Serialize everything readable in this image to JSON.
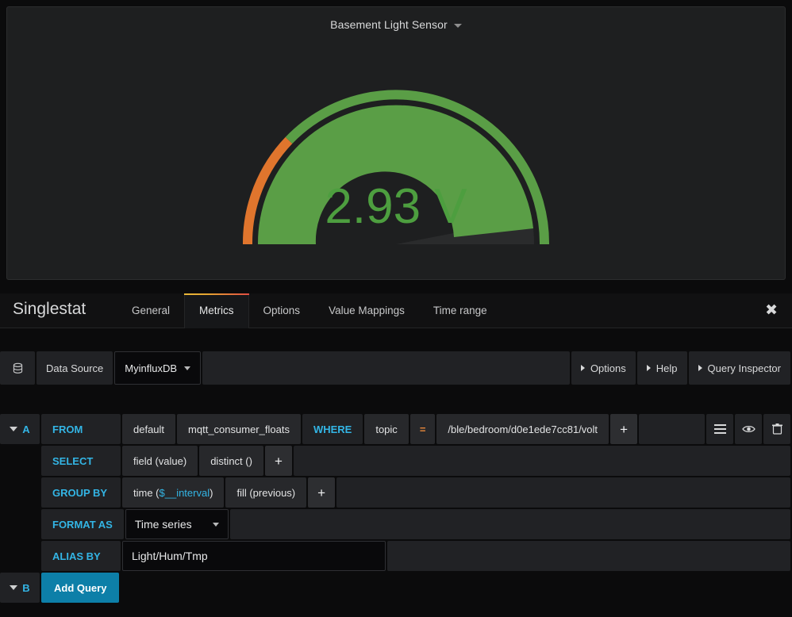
{
  "panel": {
    "title": "Basement Light Sensor",
    "title_caret_icon": "chevron-down-icon",
    "gauge": {
      "value_text": "2.93 V",
      "value": 2.93,
      "unit": "V",
      "min": 0,
      "max": 3.3,
      "value_color": "#4d9e3f",
      "threshold_low_color": "#e0752d",
      "threshold_ok_color": "#5a9e46",
      "track_color": "#2a2b2c",
      "background": "#1e1f20"
    }
  },
  "editor": {
    "title": "Singlestat",
    "close_icon": "close-icon",
    "tabs": [
      {
        "label": "General",
        "active": false
      },
      {
        "label": "Metrics",
        "active": true
      },
      {
        "label": "Options",
        "active": false
      },
      {
        "label": "Value Mappings",
        "active": false
      },
      {
        "label": "Time range",
        "active": false
      }
    ],
    "active_tab_accent_from": "#eab839",
    "active_tab_accent_to": "#e24d42"
  },
  "datasource_row": {
    "db_icon": "database-icon",
    "label": "Data Source",
    "selected": "MyinfluxDB",
    "caret_icon": "chevron-down-icon",
    "buttons": [
      {
        "label": "Options",
        "icon": "triangle-right-icon"
      },
      {
        "label": "Help",
        "icon": "triangle-right-icon"
      },
      {
        "label": "Query Inspector",
        "icon": "triangle-right-icon"
      }
    ]
  },
  "query_a": {
    "ref_id": "A",
    "collapse_icon": "chevron-down-icon",
    "from": {
      "keyword": "FROM",
      "policy": "default",
      "measurement": "mqtt_consumer_floats",
      "where_keyword": "WHERE",
      "tag_key": "topic",
      "operator": "=",
      "tag_value": "/ble/bedroom/d0e1ede7cc81/volt",
      "add_label": "+"
    },
    "select": {
      "keyword": "SELECT",
      "parts": [
        "field (value)",
        "distinct ()"
      ],
      "add_label": "+"
    },
    "group_by": {
      "keyword": "GROUP BY",
      "time_prefix": "time (",
      "time_var": "$__interval",
      "time_suffix": ")",
      "fill": "fill (previous)",
      "add_label": "+"
    },
    "format_as": {
      "keyword": "FORMAT AS",
      "value": "Time series",
      "caret_icon": "chevron-down-icon"
    },
    "alias_by": {
      "keyword": "ALIAS BY",
      "value": "Light/Hum/Tmp"
    },
    "row_actions": [
      {
        "icon": "hamburger-icon"
      },
      {
        "icon": "eye-icon"
      },
      {
        "icon": "trash-icon"
      }
    ]
  },
  "query_b": {
    "ref_id": "B",
    "collapse_icon": "chevron-down-icon",
    "add_query_label": "Add Query",
    "add_query_color": "#0d7fa8"
  }
}
